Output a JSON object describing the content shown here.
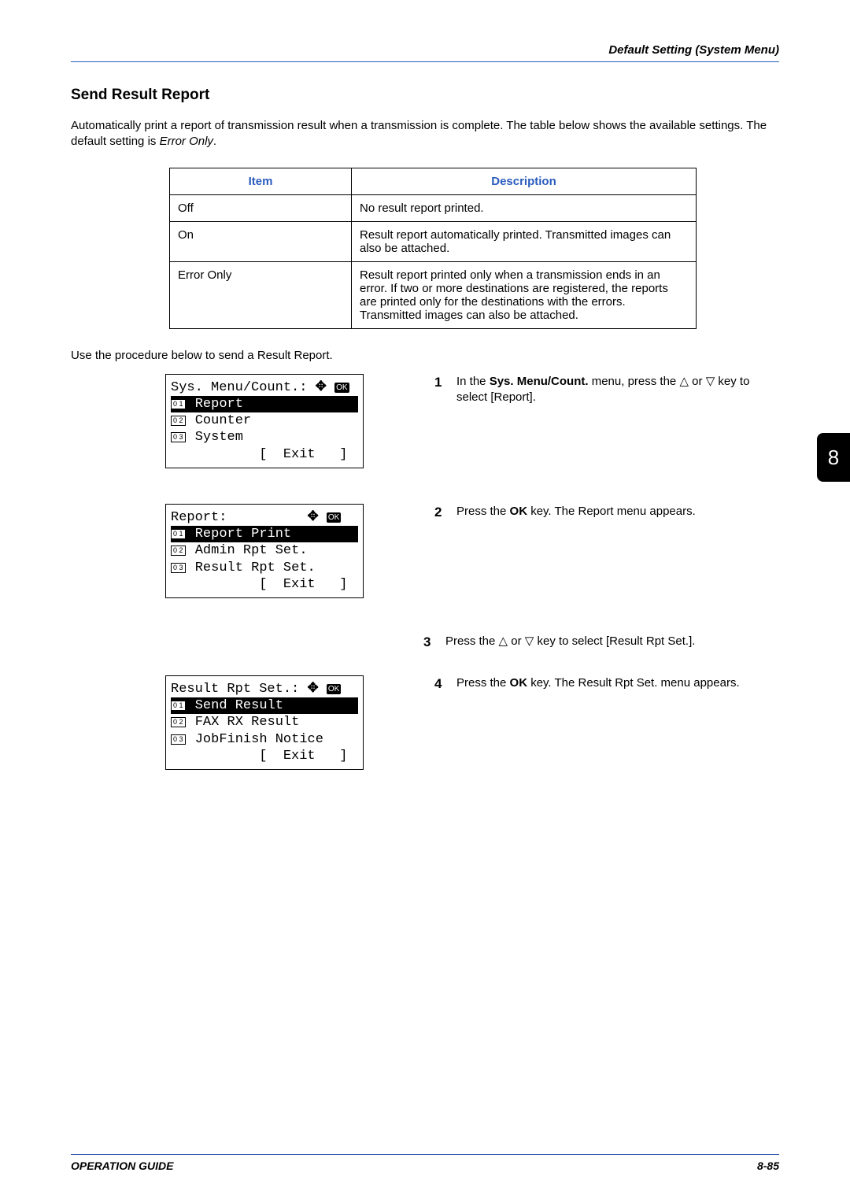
{
  "header": {
    "chapter_title": "Default Setting (System Menu)"
  },
  "section": {
    "title": "Send Result Report",
    "intro_pre": "Automatically print a report of transmission result when a transmission is complete. The table below shows the available settings. The default setting is ",
    "intro_em": "Error Only",
    "intro_post": "."
  },
  "table": {
    "head_item": "Item",
    "head_desc": "Description",
    "rows": [
      {
        "item": "Off",
        "desc": "No result report printed."
      },
      {
        "item": "On",
        "desc": "Result report automatically printed. Transmitted images can also be attached."
      },
      {
        "item": "Error Only",
        "desc": "Result report printed only when a transmission ends in an error. If two or more destinations are registered, the reports are printed only for the destinations with the errors. Transmitted images can also be attached."
      }
    ]
  },
  "procedure_intro": "Use the procedure below to send a Result Report.",
  "screens": {
    "s1": {
      "title": "Sys. Menu/Count.:",
      "items": [
        "Report",
        "Counter",
        "System"
      ],
      "exit": "[  Exit   ]"
    },
    "s2": {
      "title": "Report:",
      "items": [
        "Report Print",
        "Admin Rpt Set.",
        "Result Rpt Set."
      ],
      "exit": "[  Exit   ]"
    },
    "s3": {
      "title": "Result Rpt Set.:",
      "items": [
        "Send Result",
        "FAX RX Result",
        "JobFinish Notice"
      ],
      "exit": "[  Exit   ]"
    }
  },
  "steps": {
    "n1": "1",
    "t1_a": "In the ",
    "t1_b": "Sys. Menu/Count.",
    "t1_c": " menu, press the ",
    "t1_d": " or ",
    "t1_e": " key to select [Report].",
    "n2": "2",
    "t2_a": "Press the ",
    "t2_b": "OK",
    "t2_c": " key. The Report menu appears.",
    "n3": "3",
    "t3_a": "Press the ",
    "t3_b": " or ",
    "t3_c": " key to select [Result Rpt Set.].",
    "n4": "4",
    "t4_a": "Press the ",
    "t4_b": "OK",
    "t4_c": " key. The Result Rpt Set. menu appears."
  },
  "thumb_tab": "8",
  "footer": {
    "left": "OPERATION GUIDE",
    "right": "8-85"
  }
}
